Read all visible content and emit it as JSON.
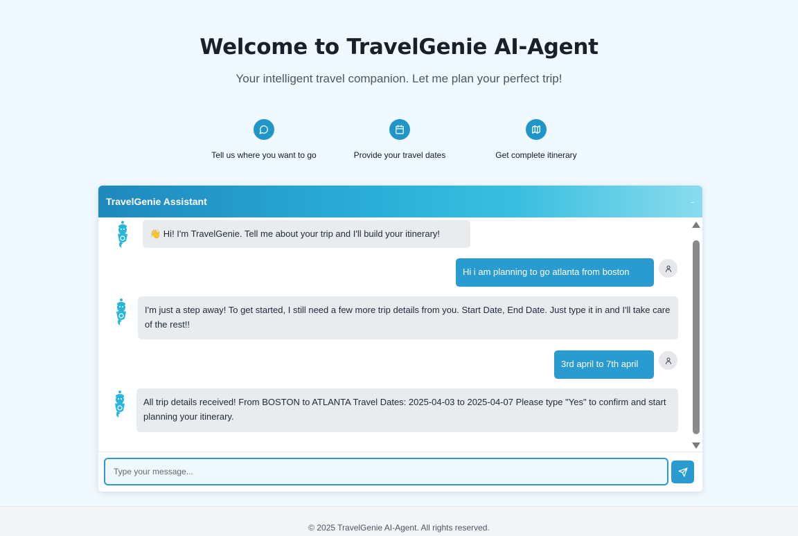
{
  "hero": {
    "title": "Welcome to TravelGenie AI-Agent",
    "subtitle": "Your intelligent travel companion. Let me plan your perfect trip!"
  },
  "steps": [
    {
      "icon": "chat-bubble-icon",
      "label": "Tell us where you want to go"
    },
    {
      "icon": "calendar-icon",
      "label": "Provide your travel dates"
    },
    {
      "icon": "map-icon",
      "label": "Get complete itinerary"
    }
  ],
  "chat": {
    "title": "TravelGenie Assistant",
    "minimize_label": "-",
    "messages": [
      {
        "sender": "bot",
        "text": "👋 Hi! I'm TravelGenie. Tell me about your trip and I'll build your itinerary!"
      },
      {
        "sender": "user",
        "text": "Hi i am planning to go atlanta from boston"
      },
      {
        "sender": "bot",
        "text": "I'm just a step away! To get started, I still need a few more trip details from you. Start Date, End Date. Just type it in and I'll take care of the rest!!"
      },
      {
        "sender": "user",
        "text": "3rd april to 7th april"
      },
      {
        "sender": "bot",
        "text": "All trip details received! From BOSTON to ATLANTA Travel Dates: 2025-04-03 to 2025-04-07 Please type \"Yes\" to confirm and start planning your itinerary."
      }
    ],
    "input": {
      "value": "",
      "placeholder": "Type your message..."
    }
  },
  "footer": {
    "text": "© 2025 TravelGenie AI-Agent. All rights reserved."
  },
  "colors": {
    "accent": "#2a9bd0",
    "genie": "#29b6dc",
    "bot_bubble": "#e8ecef"
  }
}
